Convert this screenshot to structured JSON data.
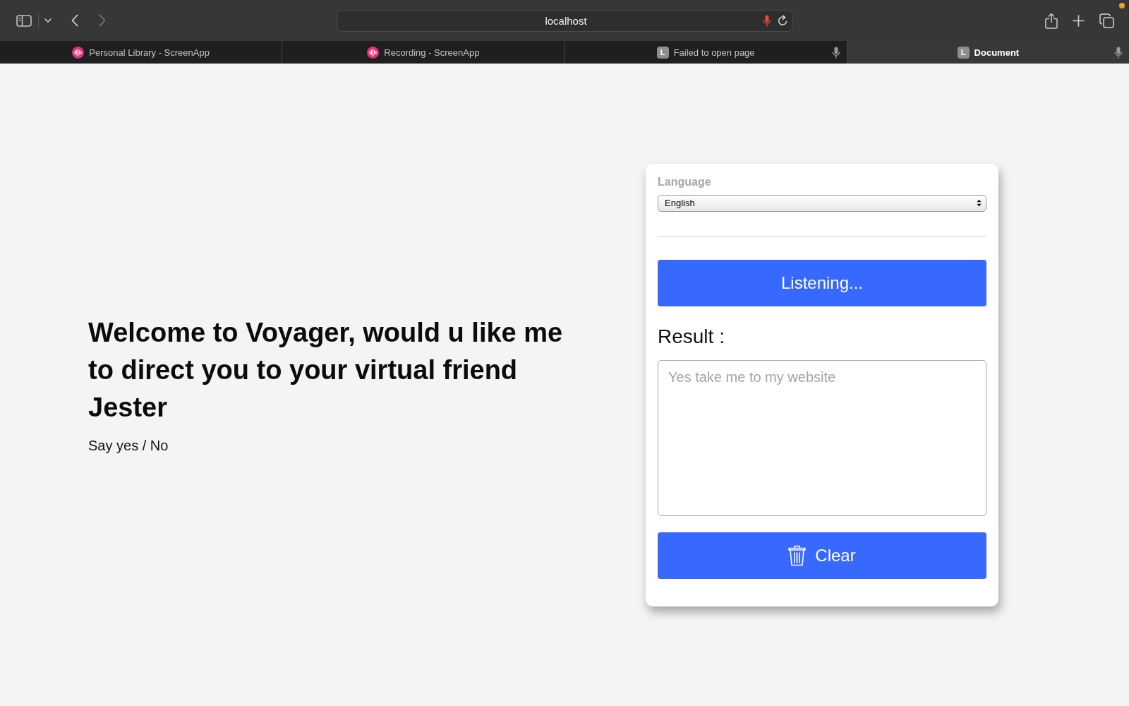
{
  "browser": {
    "address": "localhost",
    "address_mic_active": true,
    "back_disabled": false,
    "forward_disabled": true,
    "tabs": [
      {
        "title": "Personal Library - ScreenApp",
        "favicon": {
          "kind": "waveform"
        },
        "selected": false,
        "mic": false
      },
      {
        "title": "Recording - ScreenApp",
        "favicon": {
          "kind": "waveform"
        },
        "selected": false,
        "mic": false
      },
      {
        "title": "Failed to open page",
        "favicon": {
          "kind": "letter",
          "letter": "L"
        },
        "selected": false,
        "mic": true
      },
      {
        "title": "Document",
        "favicon": {
          "kind": "letter",
          "letter": "L"
        },
        "selected": true,
        "mic": true
      }
    ]
  },
  "page": {
    "heading": "Welcome to Voyager, would u like me to direct you to your virtual friend Jester",
    "prompt": "Say yes / No",
    "panel": {
      "language_label": "Language",
      "language": "English",
      "listen_button": "Listening...",
      "result_label": "Result :",
      "result_placeholder": "Yes take me to my website",
      "clear_button": "Clear"
    }
  }
}
